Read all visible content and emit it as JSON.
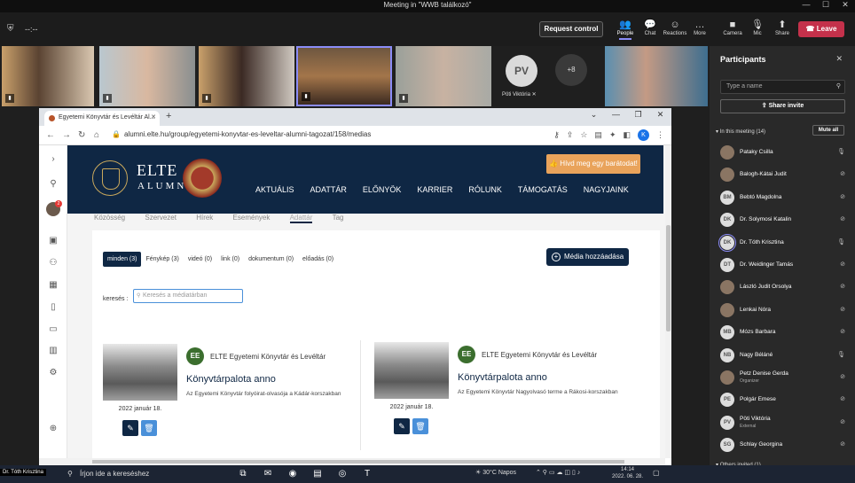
{
  "teams": {
    "window_title": "Meeting in \"WWB találkozó\"",
    "timer": "--:--",
    "request_control": "Request control",
    "toolbar": [
      {
        "label": "People",
        "icon": "people-icon",
        "glyph": "👥"
      },
      {
        "label": "Chat",
        "icon": "chat-icon",
        "glyph": "💬"
      },
      {
        "label": "Reactions",
        "icon": "reactions-icon",
        "glyph": "☺"
      },
      {
        "label": "More",
        "icon": "more-icon",
        "glyph": "…"
      },
      {
        "label": "Camera",
        "icon": "camera-icon",
        "glyph": "■"
      },
      {
        "label": "Mic",
        "icon": "mic-icon",
        "glyph": "🎙"
      },
      {
        "label": "Share",
        "icon": "share-icon",
        "glyph": "⬆"
      }
    ],
    "leave": "Leave",
    "video_tiles": {
      "pv_initials": "PV",
      "pv_name": "Pöti Viktória",
      "more_count": "+8"
    }
  },
  "browser": {
    "tab_title": "Egyetemi Könyvtár és Levéltár Al...",
    "url": "alumni.elte.hu/group/egyetemi-konyvtar-es-leveltar-alumni-tagozat/158/medias",
    "profile_initial": "K"
  },
  "site": {
    "rail_badge": "2",
    "logo_line1": "ELTE",
    "logo_line2": "ALUMNI",
    "seal_text": "ELTE ALUMNI",
    "invite_button": "Hívd meg egy barátodat!",
    "nav": [
      "AKTUÁLIS",
      "ADATTÁR",
      "ELŐNYÖK",
      "KARRIER",
      "RÓLUNK",
      "TÁMOGATÁS",
      "NAGYJAINK"
    ],
    "subtabs": [
      "Közösség",
      "Szervezet",
      "Hírek",
      "Események",
      "Adattár",
      "Tag"
    ],
    "filters": [
      "minden (3)",
      "Fénykép (3)",
      "videó (0)",
      "link (0)",
      "dokumentum (0)",
      "előadás (0)"
    ],
    "media_button": "Média hozzáadása",
    "search_label": "keresés :",
    "search_placeholder": "Keresés a médiatárban",
    "items": [
      {
        "badge": "EE",
        "author": "ELTE Egyetemi Könyvtár és Levéltár",
        "title": "Könyvtárpalota anno",
        "desc": "Az Egyetemi Könyvtár folyóirat-olvasója a Kádár-korszakban",
        "date": "2022 január 18."
      },
      {
        "badge": "EE",
        "author": "ELTE Egyetemi Könyvtár és Levéltár",
        "title": "Könyvtárpalota anno",
        "desc": "Az Egyetemi Könyvtár Nagyolvasó terme a Rákosi-korszakban",
        "date": "2022 január 18."
      }
    ]
  },
  "participants": {
    "title": "Participants",
    "search_placeholder": "Type a name",
    "share_invite": "Share invite",
    "in_meeting": "In this meeting (14)",
    "mute_all": "Mute all",
    "others": "Others invited (1)",
    "list": [
      {
        "name": "Pataky Csilla",
        "initials": "",
        "photo": true,
        "mic": "on"
      },
      {
        "name": "Balogh-Kátai Judit",
        "initials": "",
        "photo": true,
        "mic": "off"
      },
      {
        "name": "Bebtó Magdolna",
        "initials": "BM",
        "photo": false,
        "mic": "off"
      },
      {
        "name": "Dr. Solymosi Katalin",
        "initials": "DK",
        "photo": false,
        "mic": "off"
      },
      {
        "name": "Dr. Tóth Krisztina",
        "initials": "DK",
        "photo": false,
        "mic": "on"
      },
      {
        "name": "Dr. Weidinger Tamás",
        "initials": "DT",
        "photo": false,
        "mic": "off"
      },
      {
        "name": "László Judit Orsolya",
        "initials": "",
        "photo": true,
        "mic": "off"
      },
      {
        "name": "Lenkai Nóra",
        "initials": "",
        "photo": true,
        "mic": "off"
      },
      {
        "name": "Mózs Barbara",
        "initials": "MB",
        "photo": false,
        "mic": "off"
      },
      {
        "name": "Nagy Béláné",
        "initials": "NB",
        "photo": false,
        "mic": "on"
      },
      {
        "name": "Petz Denise Gerda",
        "initials": "",
        "photo": true,
        "mic": "off",
        "sub": "Organizer"
      },
      {
        "name": "Polgár Emese",
        "initials": "PE",
        "photo": false,
        "mic": "off"
      },
      {
        "name": "Pöti Viktória",
        "initials": "PV",
        "photo": false,
        "mic": "off",
        "sub": "External"
      },
      {
        "name": "Schlay Georgina",
        "initials": "SG",
        "photo": false,
        "mic": "off"
      }
    ]
  },
  "taskbar": {
    "label": "Dr. Tóth Krisztina",
    "search": "Írjon ide a kereséshez",
    "weather": "30°C Napos",
    "time": "14:14",
    "date": "2022. 06. 28."
  }
}
